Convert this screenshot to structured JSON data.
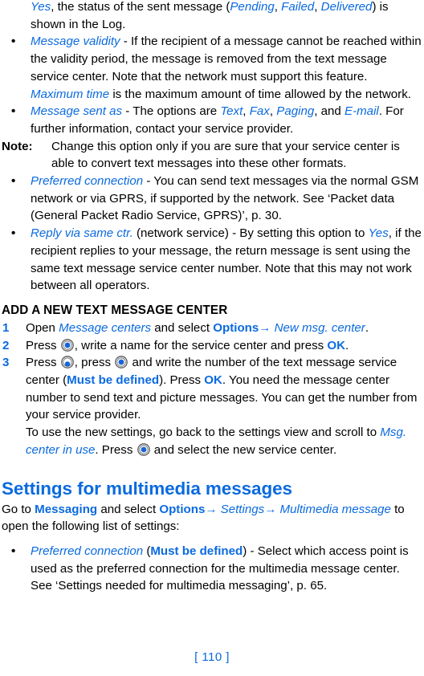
{
  "document": {
    "page_number_label": "[ 110 ]",
    "accent_color": "#0a6adf",
    "text_color": "#000000",
    "background_color": "#ffffff"
  },
  "continued_paragraph": {
    "line1_a": "Yes",
    "line1_b": ", the status of the sent message (",
    "line1_c": "Pending",
    "line1_d": ", ",
    "line1_e": "Failed",
    "line1_f": ", ",
    "line1_g": "Delivered",
    "line1_h": ") is shown in the Log."
  },
  "bullets_text_settings": [
    {
      "bullet": "•",
      "term": "Message validity",
      "body_a": " - If the recipient of a message cannot be reached within the validity period, the message is removed from the text message service center. Note that the network must support this feature. ",
      "term2": "Maximum time",
      "body_b": " is the maximum amount of time allowed by the network."
    },
    {
      "bullet": "•",
      "term": "Message sent as",
      "body_a": " - The options are ",
      "opt1": "Text",
      "sep1": ", ",
      "opt2": "Fax",
      "sep2": ", ",
      "opt3": "Paging",
      "sep3": ", and ",
      "opt4": "E-mail",
      "body_b": ". For further information, contact your service provider."
    }
  ],
  "note": {
    "label": "Note:",
    "body": "Change this option only if you are sure that your service center is able to convert text messages into these other formats."
  },
  "bullets_text_settings_2": [
    {
      "bullet": "•",
      "term": "Preferred connection",
      "body": " - You can send text messages via the normal GSM network or via GPRS, if supported by the network. See ‘Packet data (General Packet Radio Service, GPRS)’, p. 30."
    },
    {
      "bullet": "•",
      "term": "Reply via same ctr.",
      "body_a": " (network service) - By setting this option to ",
      "value": "Yes",
      "body_b": ", if the recipient replies to your message, the return message is sent using the same text message service center number. Note that this may not work between all operators."
    }
  ],
  "add_center_section": {
    "heading": "ADD A NEW TEXT MESSAGE CENTER",
    "steps": [
      {
        "number": "1",
        "a": "Open ",
        "term": "Message centers",
        "b": " and select ",
        "options": "Options",
        "arrow": "→",
        "c": " ",
        "target": "New msg. center",
        "d": "."
      },
      {
        "number": "2",
        "a": "Press ",
        "icon": "navi-key-icon",
        "b": ", write a name for the service center and press ",
        "ok": "OK",
        "c": "."
      },
      {
        "number": "3",
        "a": "Press ",
        "icon1": "navi-key-down-icon",
        "b": ", press ",
        "icon2": "navi-key-icon",
        "c": " and write the number of the text message service center (",
        "must": "Must be defined",
        "d": "). Press ",
        "ok": "OK",
        "e": ". You need the message center number to send text and picture messages. You can get the number from your service provider."
      }
    ],
    "final_note": {
      "a": "To use the new settings, go back to the settings view and scroll to ",
      "term": "Msg. center in use",
      "b": ". Press ",
      "icon": "navi-key-icon",
      "c": " and select the new service center."
    }
  },
  "multimedia_section": {
    "heading": "Settings for multimedia messages",
    "intro": {
      "a": "Go to ",
      "messaging": "Messaging",
      "b": " and select ",
      "options": "Options",
      "arrow1": "→",
      "c": " ",
      "settings": "Settings",
      "arrow2": "→",
      "d": " ",
      "multimedia": "Multimedia message",
      "e": " to open the following list of settings:"
    },
    "bullets": [
      {
        "bullet": "•",
        "term": "Preferred connection",
        "a": " (",
        "must": "Must be defined",
        "b": ") - Select which access point is used as the preferred connection for the multimedia message center. See ‘Settings needed for multimedia messaging’, p. 65."
      }
    ]
  }
}
